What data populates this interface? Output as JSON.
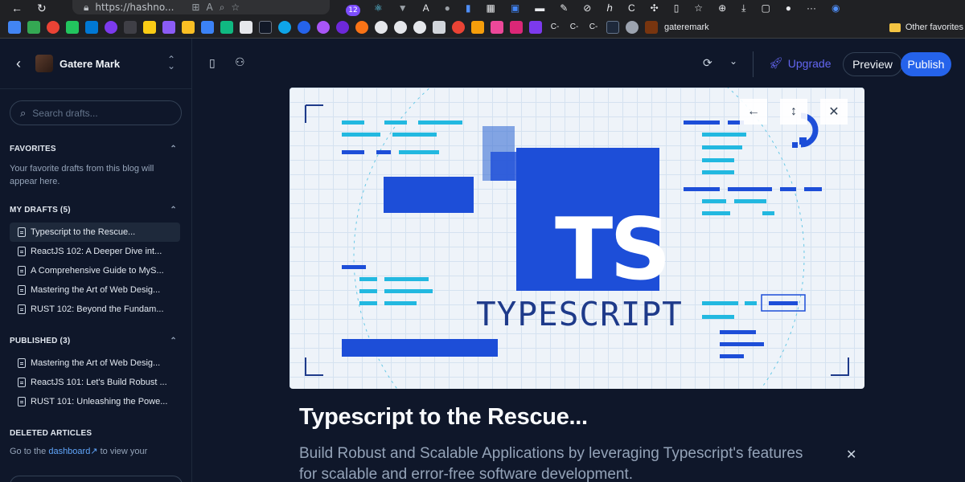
{
  "browser": {
    "url": "https://hashno...",
    "badge_count": "12",
    "profile_name": "gateremark",
    "other_favorites": "Other favorites"
  },
  "sidebar": {
    "user_name": "Gatere Mark",
    "search_placeholder": "Search drafts...",
    "favorites": {
      "heading": "FAVORITES",
      "empty_text": "Your favorite drafts from this blog will appear here."
    },
    "drafts": {
      "heading": "MY DRAFTS (5)",
      "items": [
        "Typescript to the Rescue...",
        "ReactJS 102: A Deeper Dive int...",
        "A Comprehensive Guide to MyS...",
        "Mastering the Art of Web Desig...",
        "RUST 102: Beyond the Fundam..."
      ]
    },
    "published": {
      "heading": "PUBLISHED (3)",
      "items": [
        "Mastering the Art of Web Desig...",
        "ReactJS 101: Let's Build Robust ...",
        "RUST 101: Unleashing the Powe..."
      ]
    },
    "deleted": {
      "heading": "DELETED ARTICLES",
      "text_before": "Go to the",
      "link": "dashboard",
      "text_after": "to view your deleted articles"
    }
  },
  "toolbar": {
    "upgrade_label": "Upgrade",
    "preview_label": "Preview",
    "publish_label": "Publish"
  },
  "cover": {
    "logo_letters": "TS",
    "wordmark": "TYPESCRIPT",
    "controls": [
      "←",
      "↕",
      "✕"
    ]
  },
  "article": {
    "title": "Typescript to the Rescue...",
    "subtitle": "Build Robust and Scalable Applications by leveraging Typescript's features for scalable and error-free software development."
  },
  "colors": {
    "background": "#0f172a",
    "accent": "#2563eb",
    "upgrade": "#6366f1",
    "ts_blue": "#1d4ed8"
  }
}
